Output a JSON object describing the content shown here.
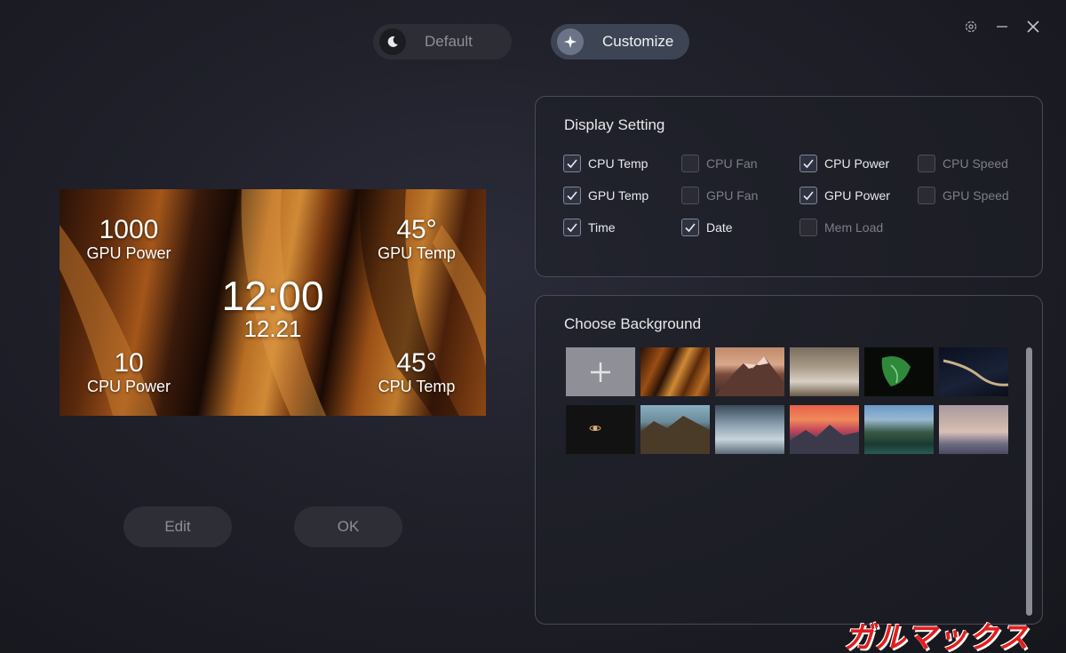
{
  "modes": {
    "default_label": "Default",
    "customize_label": "Customize"
  },
  "window_controls": [
    "settings-icon",
    "minimize-icon",
    "close-icon"
  ],
  "preview": {
    "top_left": {
      "value": "1000",
      "label": "GPU Power"
    },
    "top_right": {
      "value": "45°",
      "label": "GPU Temp"
    },
    "bottom_left": {
      "value": "10",
      "label": "CPU Power"
    },
    "bottom_right": {
      "value": "45°",
      "label": "CPU Temp"
    },
    "time": "12:00",
    "date": "12.21"
  },
  "actions": {
    "edit_label": "Edit",
    "ok_label": "OK"
  },
  "display_setting": {
    "title": "Display Setting",
    "options": [
      {
        "label": "CPU Temp",
        "checked": true
      },
      {
        "label": "CPU Fan",
        "checked": false
      },
      {
        "label": "CPU Power",
        "checked": true
      },
      {
        "label": "CPU Speed",
        "checked": false
      },
      {
        "label": "GPU Temp",
        "checked": true
      },
      {
        "label": "GPU Fan",
        "checked": false
      },
      {
        "label": "GPU Power",
        "checked": true
      },
      {
        "label": "GPU Speed",
        "checked": false
      },
      {
        "label": "Time",
        "checked": true
      },
      {
        "label": "Date",
        "checked": true
      },
      {
        "label": "Mem Load",
        "checked": false
      }
    ]
  },
  "background": {
    "title": "Choose Background",
    "add_label": "+"
  },
  "watermark": "ガルマックス",
  "colors": {
    "accent": "#3d4453",
    "panel_border": "#4a4b55",
    "watermark": "#e21d1d"
  }
}
